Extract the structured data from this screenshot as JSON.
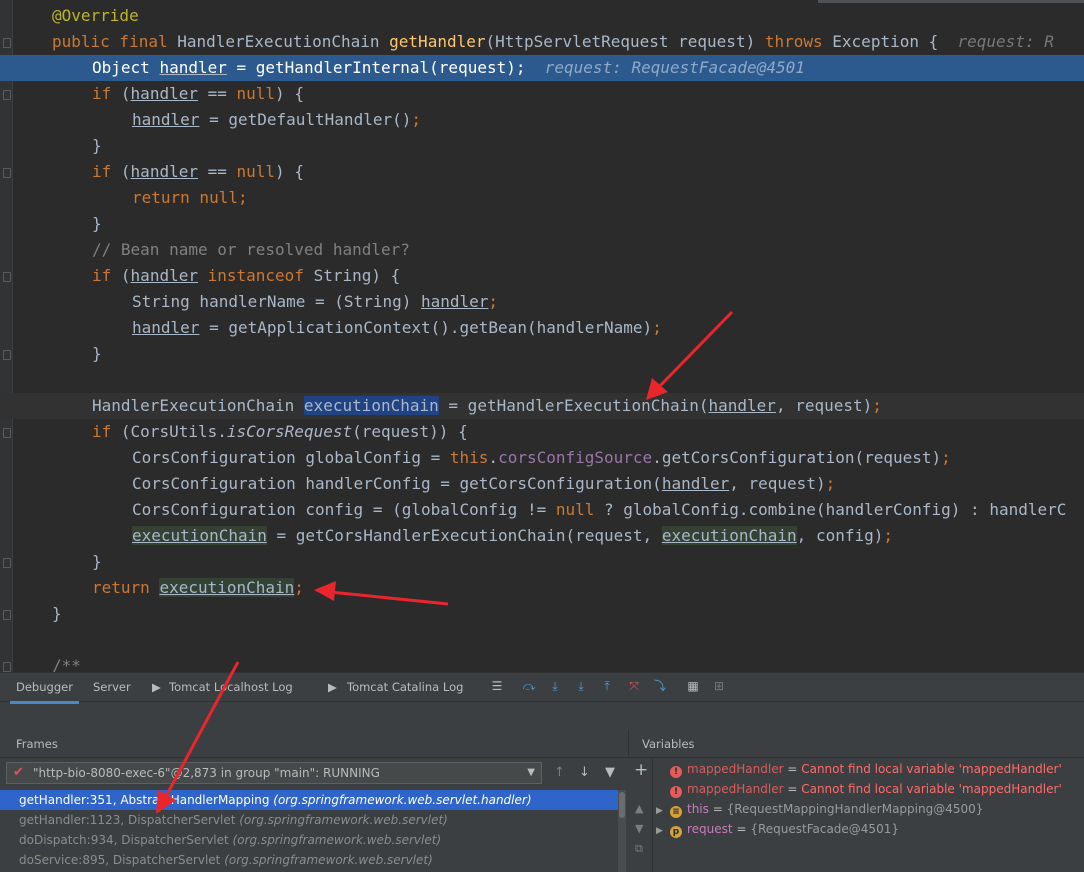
{
  "editor": {
    "lines": {
      "l1": {
        "a": "@Override"
      },
      "l2": {
        "a": "public final ",
        "b": "HandlerExecutionChain ",
        "c": "getHandler",
        "d": "(HttpServletRequest request) ",
        "e": "throws ",
        "f": "Exception {",
        "hint": "request: R"
      },
      "l3": {
        "a": "Object ",
        "b": "handler",
        "c": " = getHandlerInternal(request);",
        "hint": "request: RequestFacade@4501"
      },
      "l4": {
        "a": "if ",
        "b": "(",
        "c": "handler",
        "d": " == ",
        "e": "null",
        "f": ") {"
      },
      "l5": {
        "a": "handler",
        "b": " = getDefaultHandler()",
        "c": ";"
      },
      "l6": {
        "a": "}"
      },
      "l7": {
        "a": "if ",
        "b": "(",
        "c": "handler",
        "d": " == ",
        "e": "null",
        "f": ") {"
      },
      "l8": {
        "a": "return null;"
      },
      "l9": {
        "a": "}"
      },
      "l10": {
        "a": "// Bean name or resolved handler?"
      },
      "l11": {
        "a": "if ",
        "b": "(",
        "c": "handler",
        "d": " instanceof ",
        "e": "String) {"
      },
      "l12": {
        "a": "String handlerName = (String) ",
        "b": "handler",
        "c": ";"
      },
      "l13": {
        "a": "handler",
        "b": " = getApplicationContext().getBean(handlerName)",
        "c": ";"
      },
      "l14": {
        "a": "}"
      },
      "l15": {
        "a": "HandlerExecutionChain ",
        "b": "executionChain",
        "c": " = getHandlerExecutionChain(",
        "d": "handler",
        "e": ", request)",
        "f": ";"
      },
      "l16": {
        "a": "if ",
        "b": "(CorsUtils.",
        "c": "isCorsRequest",
        "d": "(request)) {"
      },
      "l17": {
        "a": "CorsConfiguration globalConfig = ",
        "b": "this",
        "c": ".",
        "d": "corsConfigSource",
        "e": ".getCorsConfiguration(request)",
        "f": ";"
      },
      "l18": {
        "a": "CorsConfiguration handlerConfig = getCorsConfiguration(",
        "b": "handler",
        "c": ", request)",
        "d": ";"
      },
      "l19": {
        "a": "CorsConfiguration config = (globalConfig != ",
        "b": "null",
        "c": " ? globalConfig.combine(handlerConfig) : handlerC"
      },
      "l20": {
        "a": "executionChain",
        "b": " = getCorsHandlerExecutionChain(request, ",
        "c": "executionChain",
        "d": ", config)",
        "e": ";"
      },
      "l21": {
        "a": "}"
      },
      "l22": {
        "a": "return ",
        "b": "executionChain",
        "c": ";"
      },
      "l23": {
        "a": "}"
      },
      "l24": {
        "a": "/**"
      }
    }
  },
  "debugger": {
    "tabs": [
      "Debugger",
      "Server",
      "Tomcat Localhost Log",
      "Tomcat Catalina Log"
    ],
    "frames_title": "Frames",
    "variables_title": "Variables",
    "thread": "\"http-bio-8080-exec-6\"@2,873 in group \"main\": RUNNING",
    "frames": [
      {
        "method": "getHandler:351, AbstractHandlerMapping ",
        "pkg": "(org.springframework.web.servlet.handler)"
      },
      {
        "method": "getHandler:1123, DispatcherServlet ",
        "pkg": "(org.springframework.web.servlet)"
      },
      {
        "method": "doDispatch:934, DispatcherServlet ",
        "pkg": "(org.springframework.web.servlet)"
      },
      {
        "method": "doService:895, DispatcherServlet ",
        "pkg": "(org.springframework.web.servlet)"
      }
    ],
    "variables": [
      {
        "name": "mappedHandler",
        "eq": " = ",
        "value": "Cannot find local variable 'mappedHandler'"
      },
      {
        "name": "mappedHandler",
        "eq": " = ",
        "value": "Cannot find local variable 'mappedHandler'"
      },
      {
        "name": "this",
        "eq": " = ",
        "value": "{RequestMappingHandlerMapping@4500}"
      },
      {
        "name": "request",
        "eq": " = ",
        "value": "{RequestFacade@4501}"
      }
    ],
    "colors": {
      "accent": "#2f65ca",
      "error": "#ff6b68",
      "arrow": "#e8262c"
    }
  }
}
